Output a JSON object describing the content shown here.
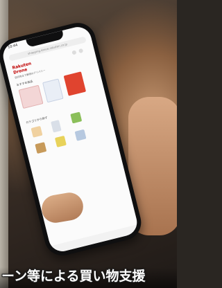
{
  "caption": "ーン等による買い物支援",
  "phone": {
    "status_time": "10:44",
    "url": "shopping.drone.rakuten.co.jp",
    "brand_line1": "Rakuten",
    "brand_line2": "Drone",
    "tagline": "目的地まで最短のデリバリー",
    "section_popular": "おすすめ商品",
    "section_category": "カテゴリから探す"
  },
  "colors": {
    "brand": "#bf0000",
    "caption_text": "#ffffff"
  }
}
